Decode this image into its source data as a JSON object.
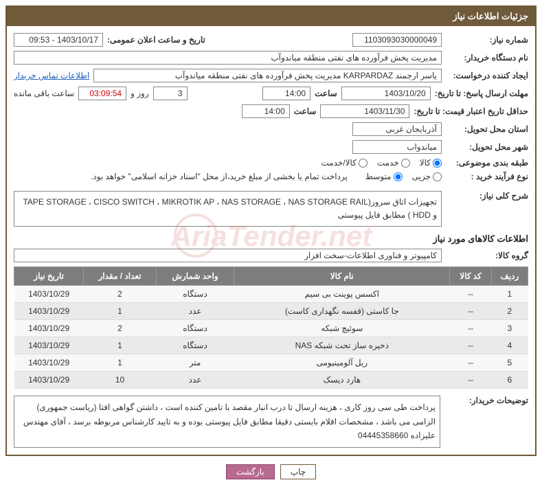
{
  "header": {
    "title": "جزئیات اطلاعات نیاز"
  },
  "fields": {
    "need_no_label": "شماره نیاز:",
    "need_no": "1103093030000049",
    "announce_label": "تاریخ و ساعت اعلان عمومی:",
    "announce_value": "1403/10/17 - 09:53",
    "buyer_org_label": "نام دستگاه خریدار:",
    "buyer_org": "مدیریت پخش فرآورده های نفتی منطقه میاندوآب",
    "creator_label": "ایجاد کننده درخواست:",
    "creator": "یاسر ارجمند KARPARDAZ مدیریت پخش فرآورده های نفتی منطقه میاندوآب",
    "contact_link": "اطلاعات تماس خریدار",
    "deadline_label": "مهلت ارسال پاسخ: تا تاریخ:",
    "deadline_date": "1403/10/20",
    "time_label": "ساعت",
    "deadline_time": "14:00",
    "days_count": "3",
    "days_word": "روز و",
    "remaining_time": "03:09:54",
    "remaining_label": "ساعت باقی مانده",
    "validity_label": "حداقل تاریخ اعتبار قیمت: تا تاریخ:",
    "validity_date": "1403/11/30",
    "validity_time": "14:00",
    "province_label": "استان محل تحویل:",
    "province": "آذربایجان غربی",
    "city_label": "شهر محل تحویل:",
    "city": "میاندواب",
    "subject_class_label": "طبقه بندی موضوعی:",
    "purchase_type_label": "نوع فرآیند خرید :",
    "purchase_note": "پرداخت تمام یا بخشی از مبلغ خرید،از محل \"اسناد خزانه اسلامی\" خواهد بود.",
    "overall_desc_label": "شرح کلی نیاز:",
    "overall_desc": "تجهیزات اتاق سرور(TAPE STORAGE ، CISCO SWITCH ، MIKROTIK AP ، NAS STORAGE ، NAS STORAGE RAIL و HDD ) مطابق فایل پیوستی",
    "goods_info_title": "اطلاعات کالاهای مورد نیاز",
    "goods_group_label": "گروه کالا:",
    "goods_group": "کامپیوتر و فناوری اطلاعات-سخت افزار",
    "buyer_note_label": "توضیحات خریدار:",
    "buyer_note": "پرداخت طی سی روز کاری ، هزینه ارسال تا درب انبار مقصد با تامین کننده است ، داشتن گواهی افتا (ریاست جمهوری) الزامی می باشد ، مشخصات اقلام بایستی دقیقا مطابق فایل پیوستی بوده و به تایید کارشناس مربوطه برسد ، آقای مهندس علیزاده 04445358660"
  },
  "radios": {
    "subject": {
      "goods": "کالا",
      "service": "خدمت",
      "goods_service": "کالا/خدمت"
    },
    "purchase": {
      "partial": "جزیی",
      "medium": "متوسط"
    }
  },
  "table": {
    "headers": {
      "row": "ردیف",
      "code": "کد کالا",
      "name": "نام کالا",
      "unit": "واحد شمارش",
      "qty": "تعداد / مقدار",
      "need_date": "تاریخ نیاز"
    },
    "rows": [
      {
        "n": "1",
        "code": "--",
        "name": "اکسس پوینت بی سیم",
        "unit": "دستگاه",
        "qty": "2",
        "date": "1403/10/29"
      },
      {
        "n": "2",
        "code": "--",
        "name": "جا کاستی (قفسه نگهداری کاست)",
        "unit": "عدد",
        "qty": "1",
        "date": "1403/10/29"
      },
      {
        "n": "3",
        "code": "--",
        "name": "سوئیچ شبکه",
        "unit": "دستگاه",
        "qty": "2",
        "date": "1403/10/29"
      },
      {
        "n": "4",
        "code": "--",
        "name": "ذخیره ساز تحت شبکه NAS",
        "unit": "دستگاه",
        "qty": "1",
        "date": "1403/10/29"
      },
      {
        "n": "5",
        "code": "--",
        "name": "ریل آلومینیومی",
        "unit": "متر",
        "qty": "1",
        "date": "1403/10/29"
      },
      {
        "n": "6",
        "code": "--",
        "name": "هارد دیسک",
        "unit": "عدد",
        "qty": "10",
        "date": "1403/10/29"
      }
    ]
  },
  "buttons": {
    "print": "چاپ",
    "back": "بازگشت"
  }
}
